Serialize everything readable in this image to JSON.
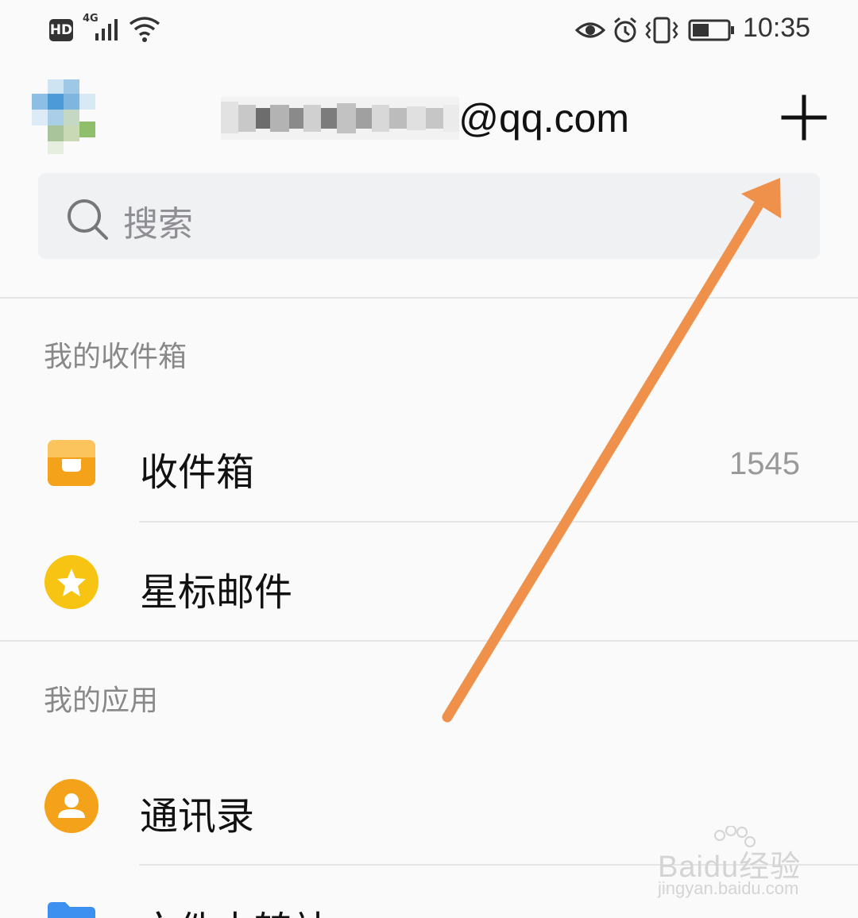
{
  "status_bar": {
    "hd_label": "HD",
    "network_label": "4G",
    "time": "10:35",
    "icons": [
      "hd-icon",
      "signal-icon",
      "wifi-icon",
      "eye-icon",
      "alarm-icon",
      "vibrate-icon",
      "battery-icon"
    ]
  },
  "header": {
    "account_suffix": "3@qq.com",
    "add_icon": "plus-icon"
  },
  "search": {
    "placeholder": "搜索",
    "icon": "search-icon"
  },
  "sections": [
    {
      "title": "我的收件箱",
      "items": [
        {
          "label": "收件箱",
          "count": "1545",
          "icon": "inbox-icon"
        },
        {
          "label": "星标邮件",
          "icon": "star-icon"
        }
      ]
    },
    {
      "title": "我的应用",
      "items": [
        {
          "label": "通讯录",
          "icon": "contacts-icon"
        },
        {
          "label": "文件中转站",
          "icon": "folder-icon"
        }
      ]
    }
  ],
  "colors": {
    "accent_orange": "#f5a21b",
    "star_yellow": "#f8c413",
    "folder_blue": "#3d8ff0",
    "annotation_arrow": "#f0914b"
  },
  "watermark": {
    "brand": "Baidu经验",
    "url": "jingyan.baidu.com"
  }
}
